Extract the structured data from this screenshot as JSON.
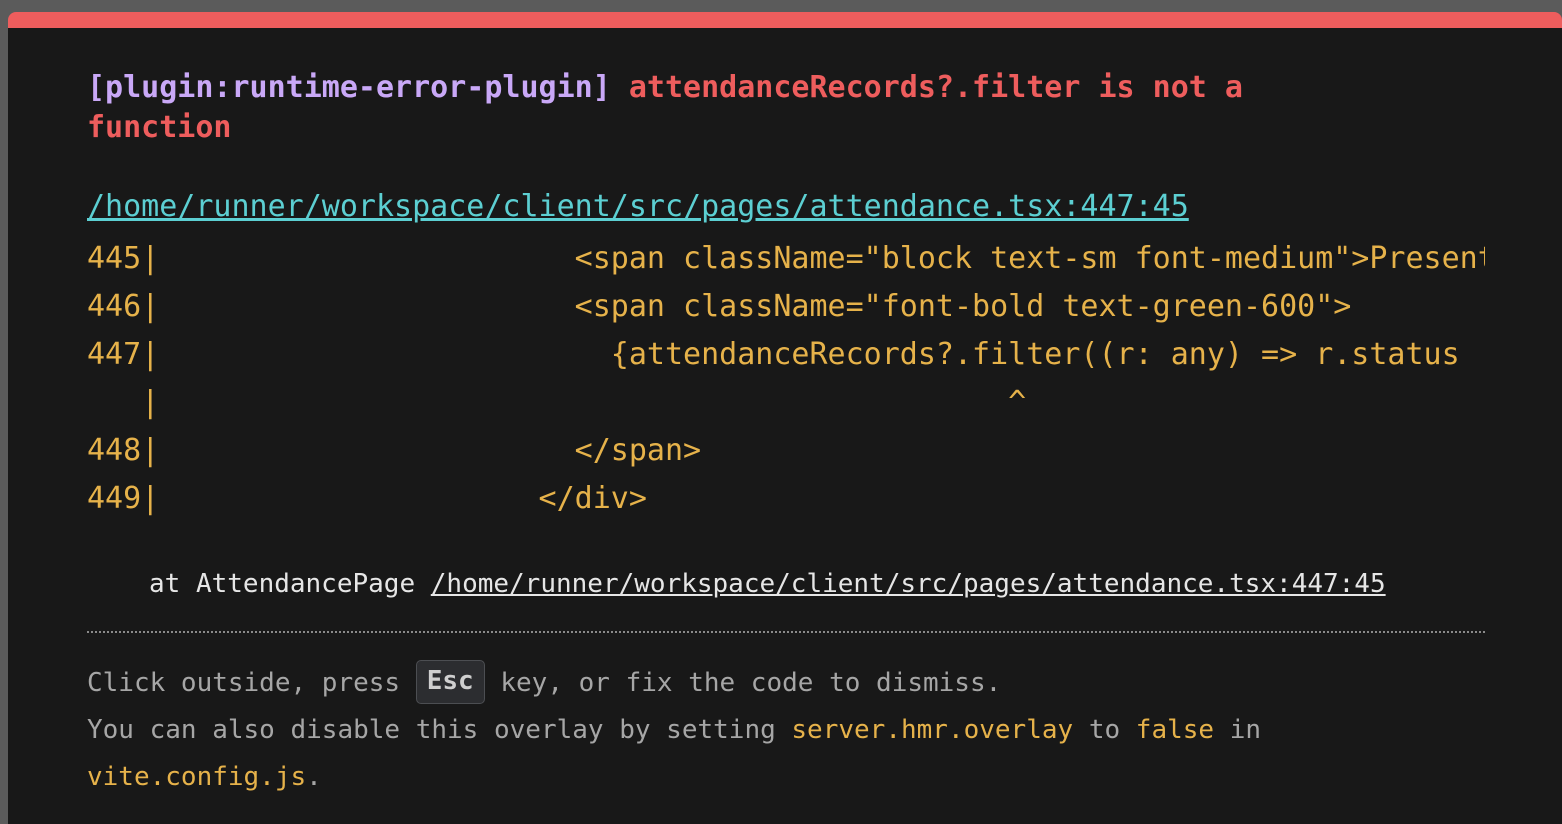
{
  "error": {
    "plugin_tag": "[plugin:runtime-error-plugin]",
    "message": "attendanceRecords?.filter is not a function"
  },
  "file_link": "/home/runner/workspace/client/src/pages/attendance.tsx:447:45",
  "code_frame": [
    {
      "num": "445",
      "sep": "|",
      "code": "                       <span className=\"block text-sm font-medium\">Present</span>"
    },
    {
      "num": "446",
      "sep": "|",
      "code": "                       <span className=\"font-bold text-green-600\">"
    },
    {
      "num": "447",
      "sep": "|",
      "code": "                         {attendanceRecords?.filter((r: any) => r.status"
    },
    {
      "num": "   ",
      "sep": "|",
      "code": "                                               ^"
    },
    {
      "num": "448",
      "sep": "|",
      "code": "                       </span>"
    },
    {
      "num": "449",
      "sep": "|",
      "code": "                     </div>"
    }
  ],
  "stack": {
    "prefix": "at AttendancePage ",
    "link": "/home/runner/workspace/client/src/pages/attendance.tsx:447:45"
  },
  "tip": {
    "line1_before": "Click outside, press ",
    "key": "Esc",
    "line1_after": " key, or fix the code to dismiss.",
    "line2_before": "You can also disable this overlay by setting ",
    "setting": "server.hmr.overlay",
    "line2_mid": " to ",
    "value": "false",
    "line2_after": " in",
    "config_file": "vite.config.js",
    "period": "."
  },
  "colors": {
    "accent_bar": "#ee5d5d",
    "background": "#181818",
    "plugin": "#c9a8f7",
    "message": "#ee5d5d",
    "link": "#5ccfd2",
    "code": "#e6b24a"
  }
}
